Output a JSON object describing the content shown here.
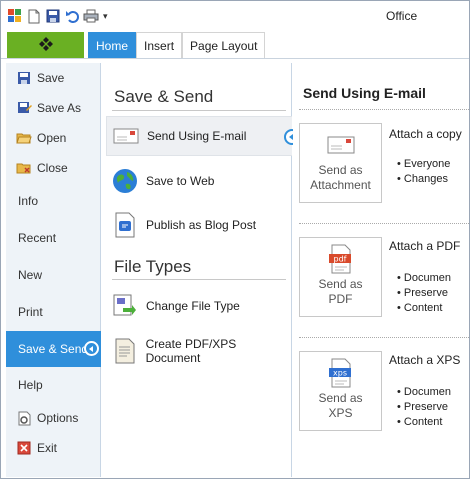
{
  "window": {
    "title": "Office"
  },
  "quick_access": {
    "icons": [
      "app-icon",
      "new-document-icon",
      "save-icon",
      "undo-icon",
      "print-icon"
    ],
    "customize_glyph": "▾"
  },
  "ribbon": {
    "file_tab_icon": "file-logo-icon",
    "tabs": [
      {
        "label": "Home",
        "active": true
      },
      {
        "label": "Insert",
        "active": false
      },
      {
        "label": "Page Layout",
        "active": false
      }
    ]
  },
  "nav": {
    "items": [
      {
        "label": "Save",
        "icon": "save-icon"
      },
      {
        "label": "Save As",
        "icon": "save-as-icon"
      },
      {
        "label": "Open",
        "icon": "open-folder-icon"
      },
      {
        "label": "Close",
        "icon": "close-folder-icon"
      },
      {
        "label": "Info",
        "icon": ""
      },
      {
        "label": "Recent",
        "icon": ""
      },
      {
        "label": "New",
        "icon": ""
      },
      {
        "label": "Print",
        "icon": ""
      },
      {
        "label": "Save & Send",
        "icon": "",
        "selected": true
      },
      {
        "label": "Help",
        "icon": ""
      },
      {
        "label": "Options",
        "icon": "options-icon"
      },
      {
        "label": "Exit",
        "icon": "exit-icon"
      }
    ]
  },
  "save_send": {
    "heading": "Save & Send",
    "items": [
      {
        "label": "Send Using E-mail",
        "icon": "email-icon",
        "selected": true
      },
      {
        "label": "Save to Web",
        "icon": "globe-icon"
      },
      {
        "label": "Publish as Blog Post",
        "icon": "blog-post-icon"
      }
    ],
    "file_types_heading": "File Types",
    "file_types": [
      {
        "label": "Change File Type",
        "icon": "change-file-type-icon"
      },
      {
        "label": "Create PDF/XPS Document",
        "icon": "pdf-xps-document-icon"
      }
    ]
  },
  "email_pane": {
    "heading": "Send Using E-mail",
    "options": [
      {
        "button": [
          "Send as",
          "Attachment"
        ],
        "icon": "envelope-icon",
        "title": "Attach a copy",
        "bullets": [
          "Everyone",
          "Changes"
        ]
      },
      {
        "button": [
          "Send as",
          "PDF"
        ],
        "icon": "pdf-icon",
        "icon_text": "pdf",
        "title": "Attach a PDF",
        "bullets": [
          "Documen",
          "Preserve",
          "Content"
        ]
      },
      {
        "button": [
          "Send as",
          "XPS"
        ],
        "icon": "xps-icon",
        "icon_text": "xps",
        "title": "Attach a XPS",
        "bullets": [
          "Documen",
          "Preserve",
          "Content"
        ]
      }
    ]
  },
  "colors": {
    "accent_blue": "#2f8fdb",
    "file_tab_green": "#6ab023",
    "nav_bg": "#eef3f8"
  }
}
